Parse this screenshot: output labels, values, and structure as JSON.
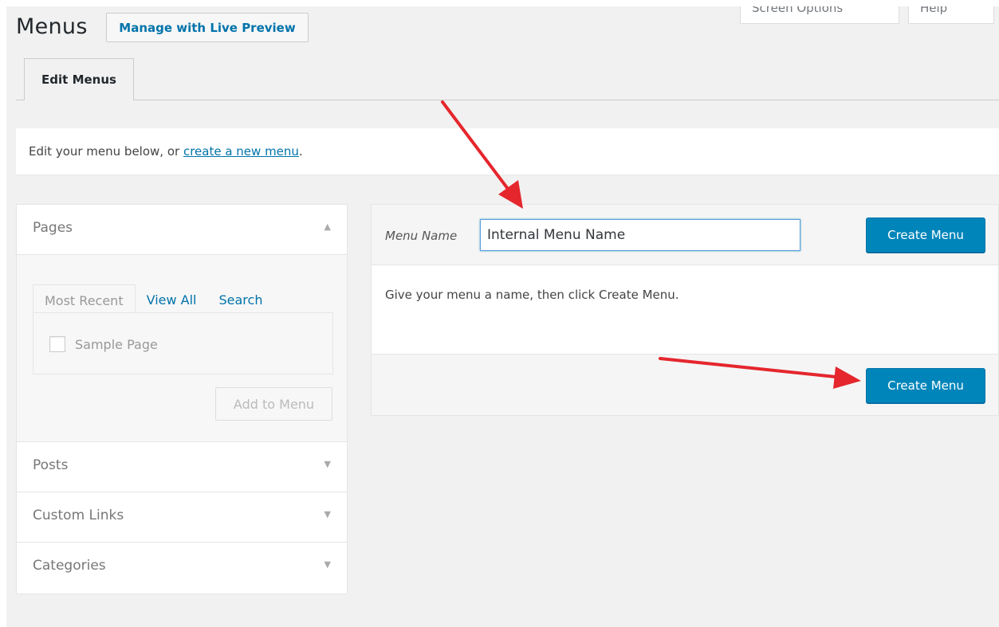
{
  "screen_meta": {
    "screen_options": "Screen Options",
    "help": "Help"
  },
  "header": {
    "title": "Menus",
    "live_preview_button": "Manage with Live Preview"
  },
  "nav_tabs": {
    "edit_menus": "Edit Menus"
  },
  "notice": {
    "text": "Edit your menu below, or ",
    "link": "create a new menu",
    "suffix": "."
  },
  "sidebar": {
    "sections": [
      {
        "label": "Pages",
        "expanded": true
      },
      {
        "label": "Posts",
        "expanded": false
      },
      {
        "label": "Custom Links",
        "expanded": false
      },
      {
        "label": "Categories",
        "expanded": false
      }
    ],
    "pages_tabs": [
      "Most Recent",
      "View All",
      "Search"
    ],
    "pages_items": [
      {
        "label": "Sample Page",
        "checked": false
      }
    ],
    "add_button": "Add to Menu"
  },
  "editor": {
    "menu_name_label": "Menu Name",
    "menu_name_value": "Internal Menu Name",
    "create_button_top": "Create Menu",
    "help_text": "Give your menu a name, then click Create Menu.",
    "create_button_bottom": "Create Menu"
  },
  "colors": {
    "primary_button": "#0085ba",
    "link": "#0073aa",
    "annotation_arrow": "#e5262d",
    "background": "#f1f1f1"
  },
  "icons": {
    "collapse": "triangle-up-icon",
    "expand": "triangle-down-icon",
    "annotation": "red-arrow-icon"
  }
}
